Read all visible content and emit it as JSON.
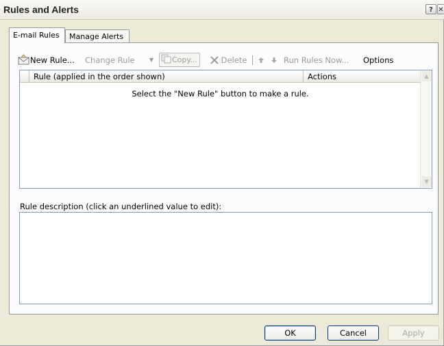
{
  "window": {
    "title": "Rules and Alerts",
    "help_glyph": "?",
    "close_glyph": "✕"
  },
  "tabs": [
    {
      "label": "E-mail Rules",
      "active": true
    },
    {
      "label": "Manage Alerts",
      "active": false
    }
  ],
  "toolbar": {
    "new_rule": "New Rule...",
    "change_rule": "Change Rule",
    "copy": "Copy...",
    "delete": "Delete",
    "run_rules_now": "Run Rules Now...",
    "options": "Options"
  },
  "rules_list": {
    "columns": [
      "Rule (applied in the order shown)",
      "Actions"
    ],
    "empty_message": "Select the \"New Rule\" button to make a rule."
  },
  "description": {
    "label": "Rule description (click an underlined value to edit):",
    "text": ""
  },
  "buttons": {
    "ok": "OK",
    "cancel": "Cancel",
    "apply": "Apply"
  },
  "icons": {
    "new_rule": "envelope-new-icon",
    "copy": "copy-icon",
    "delete": "delete-x-icon",
    "move_up": "arrow-up-icon",
    "move_down": "arrow-down-icon",
    "dropdown": "caret-down-icon"
  }
}
